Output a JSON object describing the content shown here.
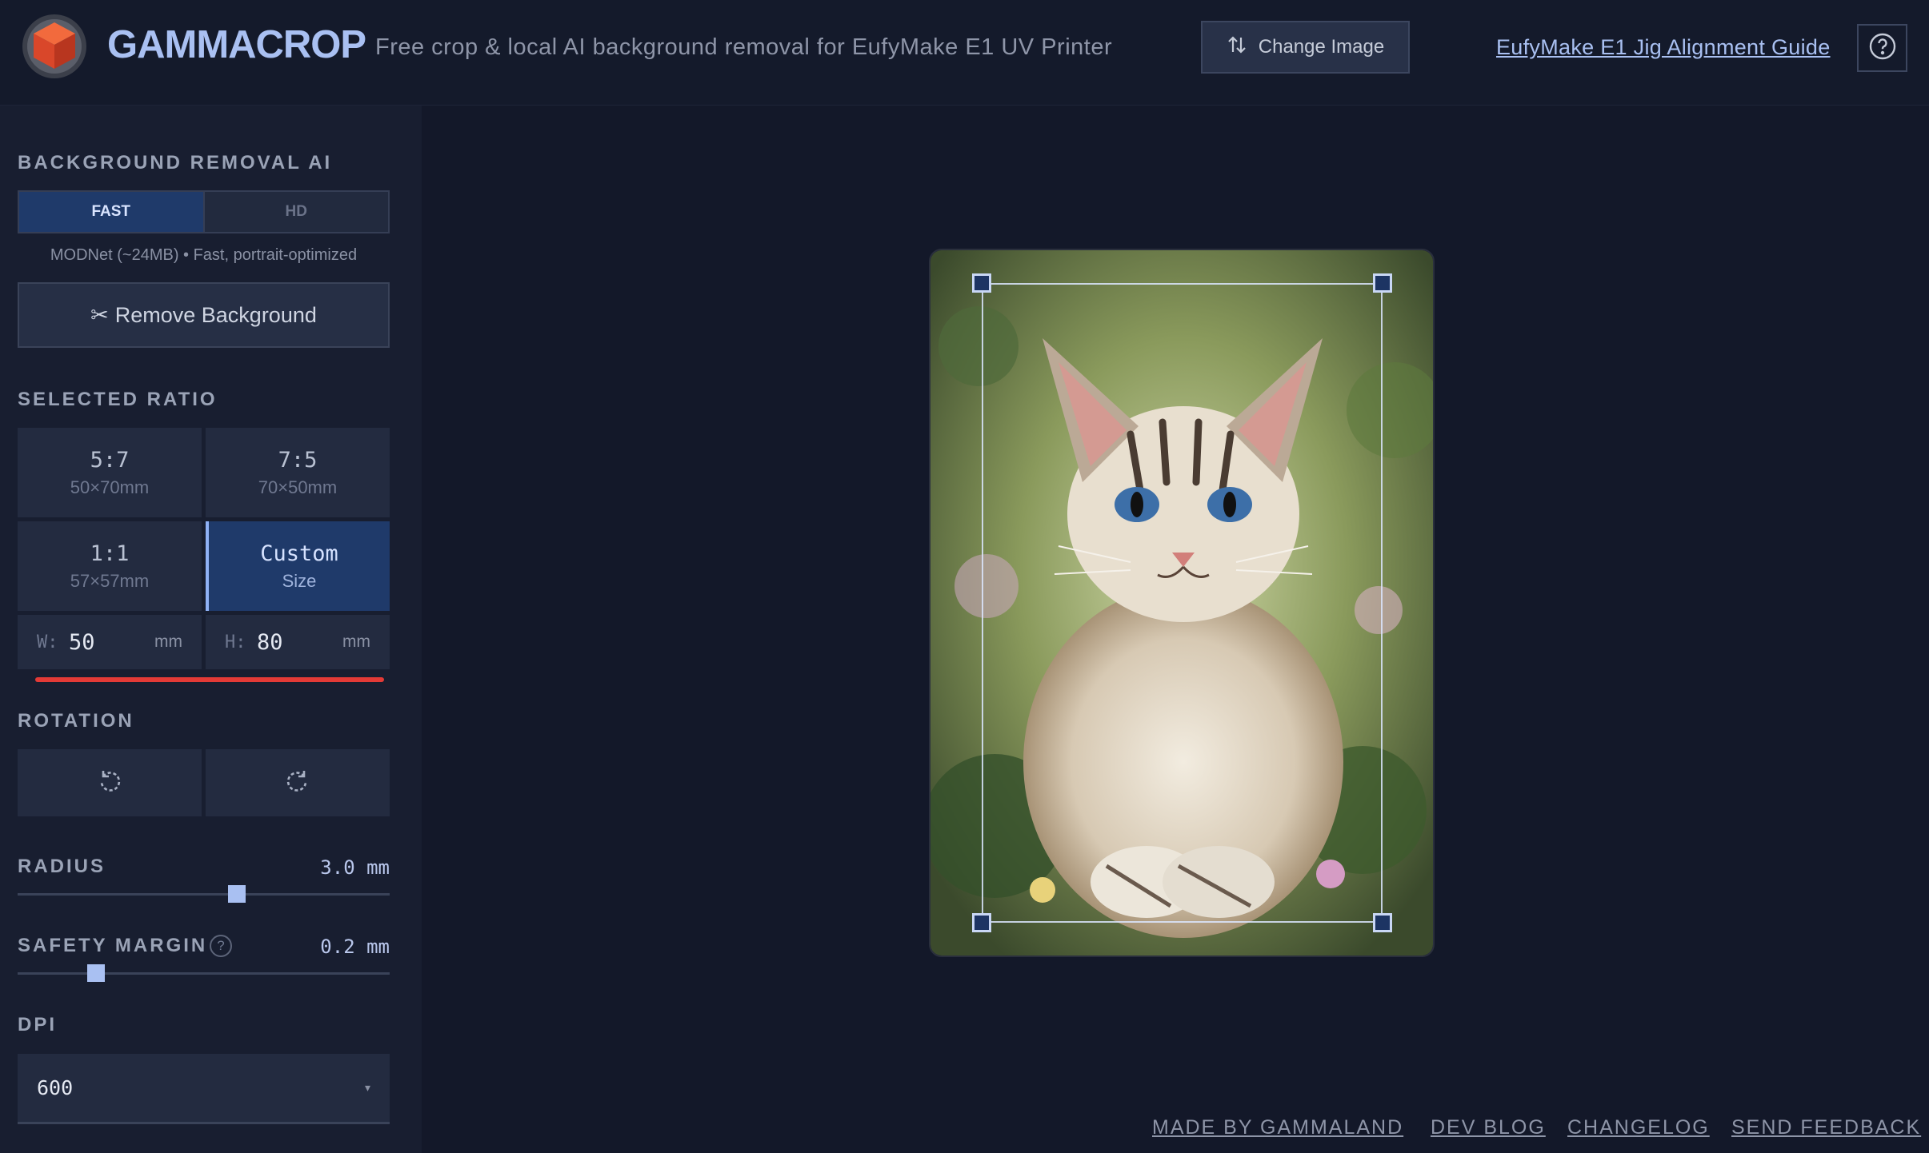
{
  "header": {
    "brand": "GAMMACROP",
    "tagline": "Free crop & local AI background removal for EufyMake E1 UV Printer",
    "change_image": "Change Image",
    "guide_link": "EufyMake E1 Jig Alignment Guide",
    "help_icon": "question-circle-icon"
  },
  "sidebar": {
    "bg_removal": {
      "label": "BACKGROUND REMOVAL AI",
      "modes": [
        "FAST",
        "HD"
      ],
      "selected_mode": "FAST",
      "model_note": "MODNet (~24MB) • Fast, portrait-optimized",
      "remove_button": "Remove Background",
      "remove_icon": "scissors-icon"
    },
    "ratio": {
      "label": "SELECTED RATIO",
      "options": [
        {
          "ratio": "5:7",
          "size": "50×70mm"
        },
        {
          "ratio": "7:5",
          "size": "70×50mm"
        },
        {
          "ratio": "1:1",
          "size": "57×57mm"
        },
        {
          "ratio": "Custom",
          "size": "Size"
        }
      ],
      "selected": "Custom",
      "width_label": "W:",
      "width_value": "50",
      "height_label": "H:",
      "height_value": "80",
      "unit": "mm"
    },
    "rotation": {
      "label": "ROTATION",
      "rotate_left_icon": "rotate-left-icon",
      "rotate_right_icon": "rotate-right-icon"
    },
    "radius": {
      "label": "RADIUS",
      "value_text": "3.0 mm",
      "slider_fraction": 0.59
    },
    "safety_margin": {
      "label": "SAFETY MARGIN",
      "help": "?",
      "value_text": "0.2 mm",
      "slider_fraction": 0.21
    },
    "dpi": {
      "label": "DPI",
      "value": "600",
      "caret": "▾"
    }
  },
  "footer": {
    "links": [
      "MADE BY GAMMALAND",
      "DEV BLOG",
      "CHANGELOG",
      "SEND FEEDBACK"
    ]
  },
  "colors": {
    "accent": "#a9c0f2",
    "selected_bg": "#1f3a6a",
    "warning_line": "#e33a36",
    "background": "#131829"
  }
}
